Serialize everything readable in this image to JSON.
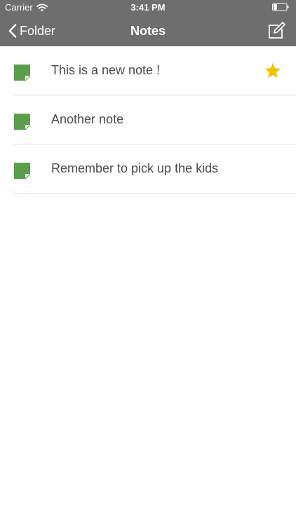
{
  "status_bar": {
    "carrier": "Carrier",
    "time": "3:41 PM",
    "wifi_icon": "wifi-icon",
    "battery_icon": "battery-icon"
  },
  "nav": {
    "back_label": "Folder",
    "title": "Notes",
    "compose_icon": "compose-icon"
  },
  "notes": [
    {
      "title": "This is a new note !",
      "starred": true
    },
    {
      "title": "Another note",
      "starred": false
    },
    {
      "title": "Remember to pick up the kids",
      "starred": false
    }
  ],
  "colors": {
    "nav_background": "#6e6e6e",
    "note_icon": "#5a9e4b",
    "star": "#f2c200",
    "text": "#4a4a4a"
  }
}
